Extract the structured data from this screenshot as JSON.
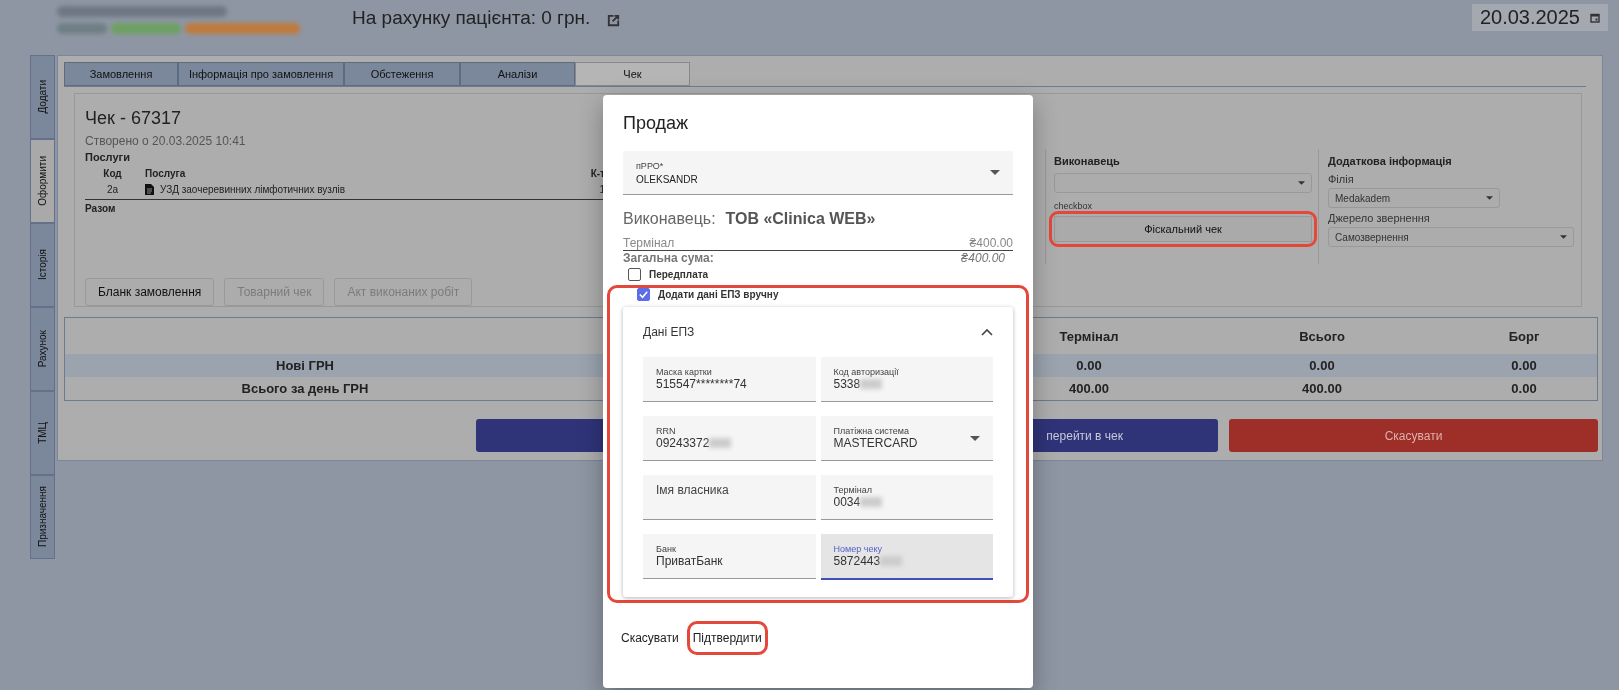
{
  "header": {
    "balance": "На рахунку пацієнта: 0 грн.",
    "date": "20.03.2025"
  },
  "side_tabs": [
    {
      "label": "Додати",
      "selected": false
    },
    {
      "label": "Оформити",
      "selected": true
    },
    {
      "label": "Історія",
      "selected": false
    },
    {
      "label": "Рахунок",
      "selected": false
    },
    {
      "label": "ТМЦ",
      "selected": false
    },
    {
      "label": "Призначення",
      "selected": false
    }
  ],
  "tabs": [
    {
      "label": "Замовлення",
      "selected": false
    },
    {
      "label": "Інформація про замовлення",
      "selected": false
    },
    {
      "label": "Обстеження",
      "selected": false
    },
    {
      "label": "Аналізи",
      "selected": false
    },
    {
      "label": "Чек",
      "selected": true
    }
  ],
  "receipt": {
    "title": "Чек - 67317",
    "created": "Створено о 20.03.2025 10:41",
    "services_heading": "Послуги",
    "columns": [
      "Код",
      "Послуга",
      "К-т"
    ],
    "rows": [
      {
        "code": "2a",
        "service": "УЗД заочеревинних лімфотичних вузлів",
        "qty": "1"
      }
    ],
    "total_label": "Разом"
  },
  "performer": {
    "heading": "Виконавець",
    "note": "checkbox",
    "fiscal_button": {
      "label": "Фіскальний чек",
      "highlighted": true
    }
  },
  "extra": {
    "heading": "Додаткова інформація",
    "fields": [
      {
        "label": "Філія",
        "value": "Medakadem"
      },
      {
        "label": "Джерело звернення",
        "value": "Самозвернення"
      }
    ]
  },
  "doc_buttons": [
    {
      "label": "Бланк замовлення",
      "disabled": false
    },
    {
      "label": "Товарний чек",
      "disabled": true
    },
    {
      "label": "Акт виконаних робіт",
      "disabled": true
    }
  ],
  "summary": {
    "columns": [
      "Термінал",
      "Всього",
      "Борг"
    ],
    "rows": [
      {
        "label": "Нові ГРН",
        "values": [
          "0.00",
          "0.00",
          "0.00"
        ]
      },
      {
        "label": "Всього за день ГРН",
        "values": [
          "400.00",
          "400.00",
          "0.00"
        ]
      }
    ]
  },
  "actions": [
    {
      "label": "перейти в чек",
      "kind": "primary"
    },
    {
      "label": "Скасувати",
      "kind": "danger"
    }
  ],
  "dialog": {
    "title": "Продаж",
    "prro": {
      "label": "пРРО*",
      "value": "OLEKSANDR"
    },
    "performer_label": "Виконавець:",
    "performer_value": "ТОВ «Clinica WEB»",
    "lines": [
      {
        "label": "Термінал",
        "amount": "₴400.00",
        "kind": "line"
      },
      {
        "label": "Загальна сума:",
        "amount": "₴400.00",
        "kind": "total"
      }
    ],
    "checkboxes": [
      {
        "label": "Передплата",
        "checked": false
      },
      {
        "label": "Додати дані ЕПЗ вручну",
        "checked": true
      }
    ],
    "epz": {
      "highlighted": true,
      "title": "Дані ЕПЗ",
      "expanded": true,
      "fields": [
        {
          "label": "Маска картки",
          "value": "515547********74",
          "kind": "text",
          "focused": false,
          "redacted": false
        },
        {
          "label": "Код авторизації",
          "value": "5338",
          "kind": "text",
          "focused": false,
          "redacted": true
        },
        {
          "label": "RRN",
          "value": "09243372",
          "kind": "text",
          "focused": false,
          "redacted": true
        },
        {
          "label": "Платіжна система",
          "value": "MASTERCARD",
          "kind": "select",
          "focused": false,
          "redacted": false
        },
        {
          "placeholder": "Імя власника",
          "kind": "text",
          "focused": false
        },
        {
          "label": "Термінал",
          "value": "0034",
          "kind": "text",
          "focused": false,
          "redacted": true
        },
        {
          "label": "Банк",
          "value": "ПриватБанк",
          "kind": "text",
          "focused": false,
          "redacted": false
        },
        {
          "label": "Номер чеку",
          "value": "5872443",
          "kind": "text",
          "focused": true,
          "redacted": true
        }
      ]
    },
    "buttons": [
      {
        "label": "Скасувати",
        "highlighted": false
      },
      {
        "label": "Підтвердити",
        "highlighted": true
      }
    ]
  }
}
